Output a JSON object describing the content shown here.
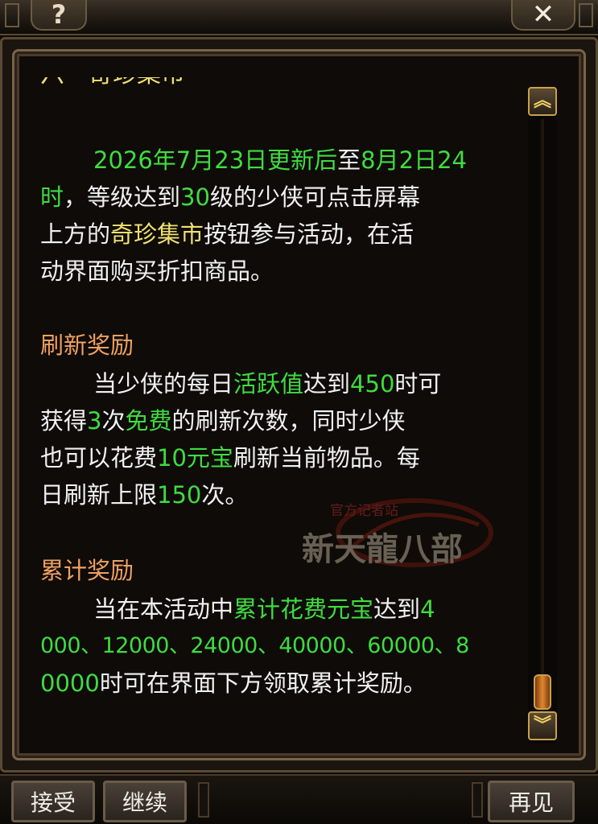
{
  "top_bar": {
    "help_glyph": "?",
    "close_glyph": "✕"
  },
  "panel": {
    "partial_title": "六・奇珍集市",
    "para1": {
      "l1_green_a": "2026年7月23日更新后",
      "l1_white": "至",
      "l1_green_b": "8月2日24",
      "l2_green_a": "时",
      "l2_white_a": "，等级达到",
      "l2_green_b": "30",
      "l2_white_b": "级的少侠可点击屏幕",
      "l3_white_a": "上方的",
      "l3_yellow": "奇珍集市",
      "l3_white_b": "按钮参与活动，在活",
      "l4_white": "动界面购买折扣商品。"
    },
    "section2_title": "刷新奖励",
    "para2": {
      "l1_white_a": "当少侠的每日",
      "l1_green_a": "活跃值",
      "l1_white_b": "达到",
      "l1_green_b": "450",
      "l1_white_c": "时可",
      "l2_white_a": "获得",
      "l2_green_a": "3",
      "l2_white_b": "次",
      "l2_green_b": "免费",
      "l2_white_c": "的刷新次数，同时少侠",
      "l3_white_a": "也可以花费",
      "l3_green": "10元宝",
      "l3_white_b": "刷新当前物品。每",
      "l4_white_a": "日刷新上限",
      "l4_green": "150",
      "l4_white_b": "次。"
    },
    "section3_title": "累计奖励",
    "para3": {
      "l1_white_a": "当在本活动中",
      "l1_green_a": "累计花费元宝",
      "l1_white_b": "达到",
      "l1_green_b": "4",
      "l2_green": "000、12000、24000、40000、60000、8",
      "l3_green": "0000",
      "l3_white": "时可在界面下方领取累计奖励。"
    }
  },
  "watermark": {
    "small_text": "官方记者站",
    "logo_text": "新天龍八部"
  },
  "scrollbar": {
    "up_glyph": "︽",
    "down_glyph": "︾"
  },
  "buttons": {
    "accept": "接受",
    "continue": "继续",
    "goodbye": "再见"
  },
  "colors": {
    "highlight_green": "#3fdc3f",
    "highlight_yellow": "#f0e070",
    "section_orange": "#f0a060",
    "frame_gold": "#c8a24a"
  }
}
